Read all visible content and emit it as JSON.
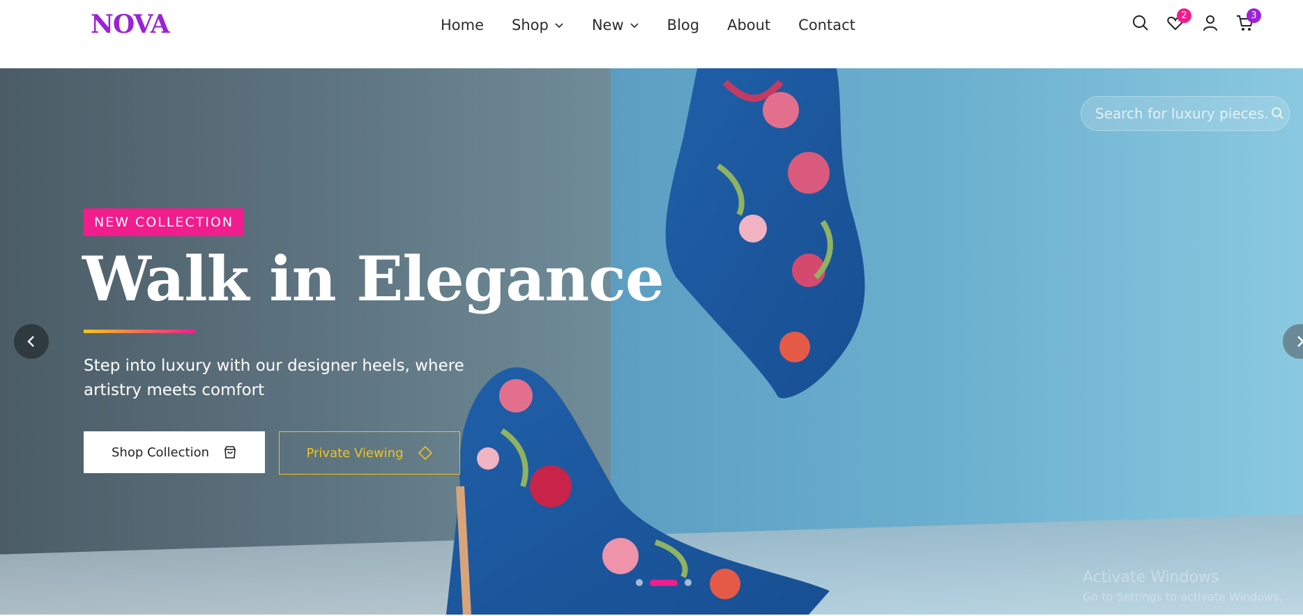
{
  "brand": {
    "logo": "NOVA",
    "accent": "#f01d8d",
    "purple": "#9b22d6",
    "gold": "#f2c318"
  },
  "nav": {
    "items": [
      {
        "label": "Home",
        "dropdown": false
      },
      {
        "label": "Shop",
        "dropdown": true
      },
      {
        "label": "New",
        "dropdown": true
      },
      {
        "label": "Blog",
        "dropdown": false
      },
      {
        "label": "About",
        "dropdown": false
      },
      {
        "label": "Contact",
        "dropdown": false
      }
    ]
  },
  "header_icons": {
    "search": "search-icon",
    "wishlist": {
      "icon": "heart-icon",
      "count": "2"
    },
    "account": "user-icon",
    "cart": {
      "icon": "cart-icon",
      "count": "3"
    }
  },
  "hero": {
    "tag": "NEW COLLECTION",
    "title": "Walk in Elegance",
    "subtitle": "Step into luxury with our designer heels, where artistry meets comfort",
    "primary_button": "Shop Collection",
    "secondary_button": "Private Viewing",
    "search_placeholder": "Search for luxury pieces...",
    "slides": 3,
    "active_slide": 2
  },
  "os_watermark": {
    "line1": "Activate Windows",
    "line2": "Go to Settings to activate Windows."
  }
}
